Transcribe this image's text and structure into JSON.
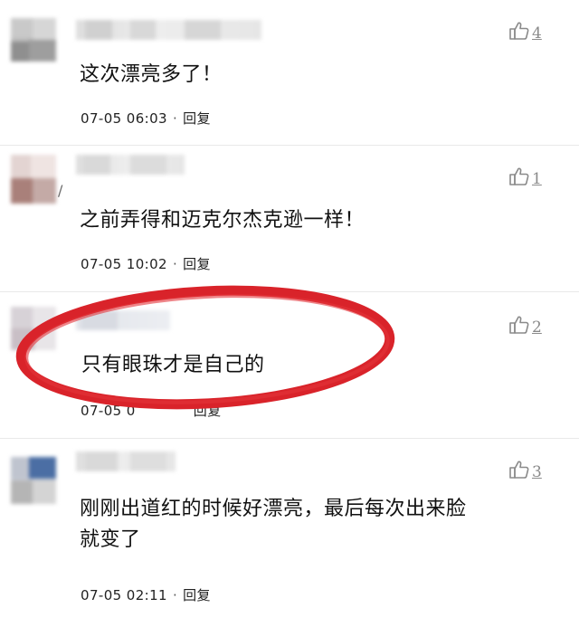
{
  "comments": [
    {
      "text": "这次漂亮多了！",
      "time": "07-05 06:03",
      "reply": "回复",
      "likes": "4"
    },
    {
      "text": "之前弄得和迈克尔杰克逊一样！",
      "time": "07-05 10:02",
      "reply": "回复",
      "likes": "1"
    },
    {
      "text": "只有眼珠才是自己的",
      "time_visible": "07-05 0",
      "reply": "回复",
      "likes": "2"
    },
    {
      "text": "刚刚出道红的时候好漂亮，最后每次出来脸\n就变了",
      "time": "07-05 02:11",
      "reply": "回复",
      "likes": "3"
    }
  ],
  "meta_separator": "·",
  "icons": {
    "like": "thumbs-up-icon"
  },
  "colors": {
    "highlight_ellipse": "#d9232a",
    "meta_text": "#222222",
    "like_gray": "#8a8a8a"
  }
}
